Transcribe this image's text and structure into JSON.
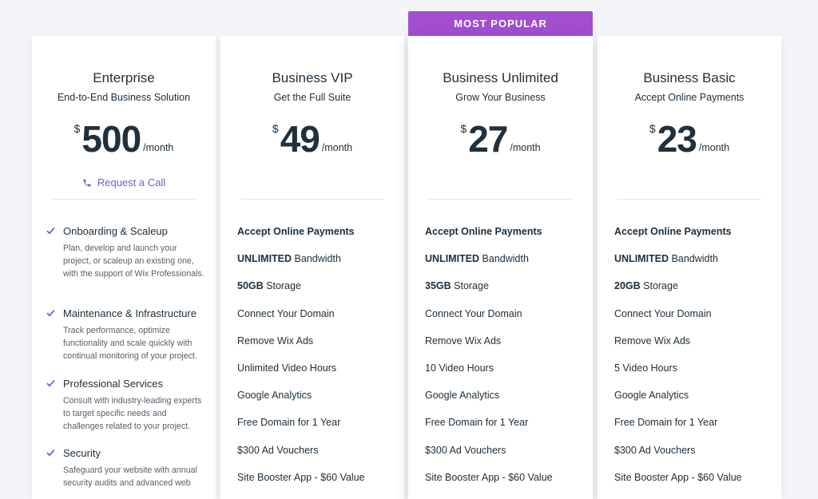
{
  "badge": "MOST POPULAR",
  "plans": [
    {
      "name": "Enterprise",
      "subtitle": "End-to-End Business Solution",
      "currency": "$",
      "price": "500",
      "period": "/month",
      "request_call": "Request a Call",
      "features": [
        {
          "title": "Onboarding & Scaleup",
          "desc": "Plan, develop and launch your project, or scaleup an existing one, with the support of Wix Professionals."
        },
        {
          "title": "Maintenance & Infrastructure",
          "desc": "Track performance, optimize functionality and scale quickly with continual monitoring of your project."
        },
        {
          "title": "Professional Services",
          "desc": "Consult with industry-leading experts to target specific needs and challenges related to your project."
        },
        {
          "title": "Security",
          "desc": "Safeguard your website with annual security audits and advanced web"
        }
      ]
    },
    {
      "name": "Business VIP",
      "subtitle": "Get the Full Suite",
      "currency": "$",
      "price": "49",
      "period": "/month",
      "features": [
        {
          "bold": "Accept Online Payments",
          "text": ""
        },
        {
          "bold": "UNLIMITED",
          "text": " Bandwidth"
        },
        {
          "bold": "50GB",
          "text": " Storage"
        },
        {
          "bold": "",
          "text": "Connect Your Domain"
        },
        {
          "bold": "",
          "text": "Remove Wix Ads"
        },
        {
          "bold": "",
          "text": "Unlimited Video Hours"
        },
        {
          "bold": "",
          "text": "Google Analytics"
        },
        {
          "bold": "",
          "text": "Free Domain for 1 Year"
        },
        {
          "bold": "",
          "text": "$300 Ad Vouchers"
        },
        {
          "bold": "",
          "text": "Site Booster App - $60 Value"
        }
      ]
    },
    {
      "name": "Business Unlimited",
      "subtitle": "Grow Your Business",
      "currency": "$",
      "price": "27",
      "period": "/month",
      "features": [
        {
          "bold": "Accept Online Payments",
          "text": ""
        },
        {
          "bold": "UNLIMITED",
          "text": " Bandwidth"
        },
        {
          "bold": "35GB",
          "text": " Storage"
        },
        {
          "bold": "",
          "text": "Connect Your Domain"
        },
        {
          "bold": "",
          "text": "Remove Wix Ads"
        },
        {
          "bold": "",
          "text": "10 Video Hours"
        },
        {
          "bold": "",
          "text": "Google Analytics"
        },
        {
          "bold": "",
          "text": "Free Domain for 1 Year"
        },
        {
          "bold": "",
          "text": "$300 Ad Vouchers"
        },
        {
          "bold": "",
          "text": "Site Booster App - $60 Value"
        }
      ]
    },
    {
      "name": "Business Basic",
      "subtitle": "Accept Online Payments",
      "currency": "$",
      "price": "23",
      "period": "/month",
      "features": [
        {
          "bold": "Accept Online Payments",
          "text": ""
        },
        {
          "bold": "UNLIMITED",
          "text": " Bandwidth"
        },
        {
          "bold": "20GB",
          "text": " Storage"
        },
        {
          "bold": "",
          "text": "Connect Your Domain"
        },
        {
          "bold": "",
          "text": "Remove Wix Ads"
        },
        {
          "bold": "",
          "text": "5 Video Hours"
        },
        {
          "bold": "",
          "text": "Google Analytics"
        },
        {
          "bold": "",
          "text": "Free Domain for 1 Year"
        },
        {
          "bold": "",
          "text": "$300 Ad Vouchers"
        },
        {
          "bold": "",
          "text": "Site Booster App - $60 Value"
        }
      ]
    }
  ],
  "colors": {
    "accent": "#a24fd1",
    "link": "#6a5fd6",
    "check": "#5b52d6",
    "text": "#20303c"
  },
  "icons": {
    "phone": "phone-icon",
    "check": "check-icon"
  }
}
